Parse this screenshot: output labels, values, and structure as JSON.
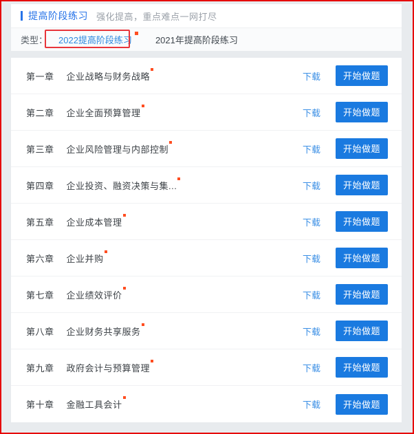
{
  "header": {
    "title": "提高阶段练习",
    "subtitle": "强化提高，重点难点一网打尽",
    "tab_label": "类型：",
    "tabs": [
      {
        "label": "2022提高阶段练习",
        "active": true,
        "badge": true
      },
      {
        "label": "2021年提高阶段练习",
        "active": false,
        "badge": false
      }
    ]
  },
  "actions": {
    "download_label": "下载",
    "start_label": "开始做题"
  },
  "colors": {
    "accent_blue": "#2673e8",
    "link_blue": "#3b8fe5",
    "button_blue": "#1a7ae0",
    "badge_red": "#ff4d20",
    "annotation_red": "#e8343a",
    "page_bg": "#e8ebee"
  },
  "chapters": [
    {
      "number": "第一章",
      "title": "企业战略与财务战略",
      "badge": true
    },
    {
      "number": "第二章",
      "title": "企业全面预算管理",
      "badge": true
    },
    {
      "number": "第三章",
      "title": "企业风险管理与内部控制",
      "badge": true
    },
    {
      "number": "第四章",
      "title": "企业投资、融资决策与集...",
      "badge": true
    },
    {
      "number": "第五章",
      "title": "企业成本管理",
      "badge": true
    },
    {
      "number": "第六章",
      "title": "企业并购",
      "badge": true
    },
    {
      "number": "第七章",
      "title": "企业绩效评价",
      "badge": true
    },
    {
      "number": "第八章",
      "title": "企业财务共享服务",
      "badge": true
    },
    {
      "number": "第九章",
      "title": "政府会计与预算管理",
      "badge": true
    },
    {
      "number": "第十章",
      "title": "金融工具会计",
      "badge": true
    }
  ]
}
